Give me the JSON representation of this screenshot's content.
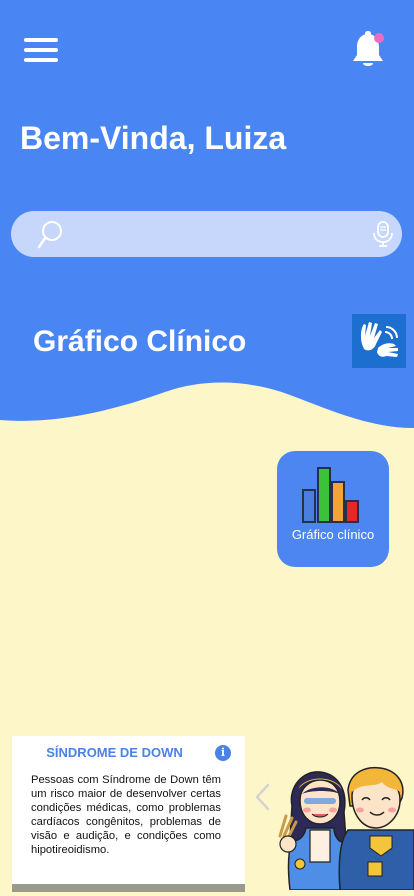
{
  "header": {
    "greeting": "Bem-Vinda, Luiza",
    "menu_icon": "hamburger-menu-icon",
    "notification_icon": "bell-icon",
    "has_notification": true
  },
  "search": {
    "value": "",
    "placeholder": "",
    "search_icon": "magnifier-icon",
    "voice_icon": "microphone-icon"
  },
  "section": {
    "title": "Gráfico Clínico",
    "accessibility_icon": "sign-language-icon"
  },
  "shortcuts": [
    {
      "label": "Gráfico clínico",
      "icon": "bar-chart-icon"
    }
  ],
  "info_card": {
    "title": "SÍNDROME DE DOWN",
    "info_icon": "i",
    "text": "Pessoas com Síndrome de Down têm um risco maior de desenvolver certas condições médicas, como problemas cardíacos congênitos, problemas de visão e audição, e condições como hipotireoidismo."
  },
  "colors": {
    "primary_blue": "#4a85f4",
    "background_cream": "#fdf6c8",
    "search_bg": "#c7d7fb",
    "notification_dot": "#ec6cc3",
    "card_blue": "#4d86f0"
  }
}
